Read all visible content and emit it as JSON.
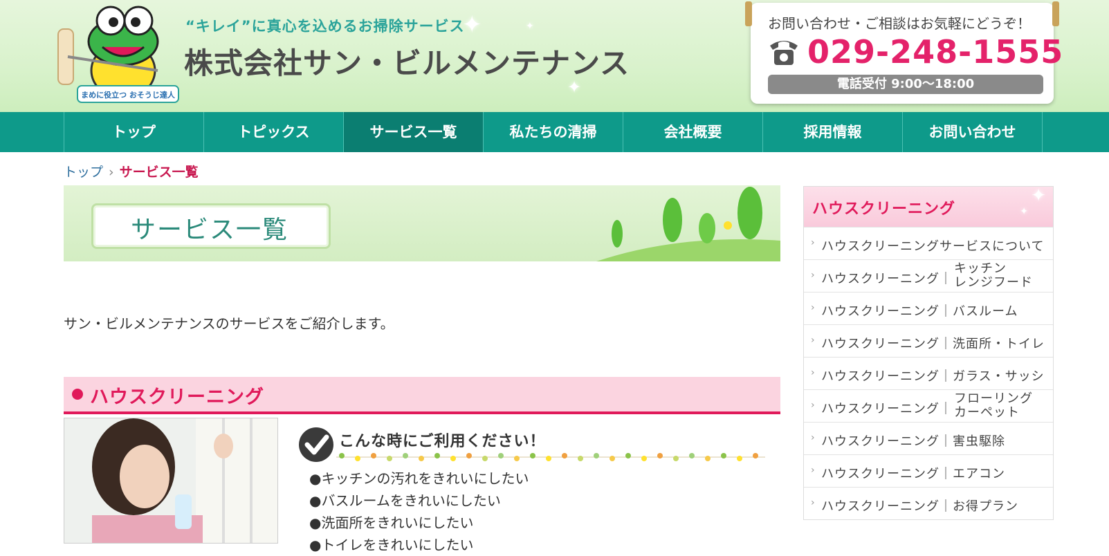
{
  "header": {
    "tagline": "“キレイ”に真心を込めるお掃除サービス",
    "company_name": "株式会社サン・ビルメンテナンス",
    "logo_caption": "まめに役立つ おそうじ達人",
    "contact_message": "お問い合わせ・ご相談はお気軽にどうぞ！",
    "phone": "029-248-1555",
    "hours": "電話受付  9:00〜18:00"
  },
  "nav": {
    "items": [
      "トップ",
      "トピックス",
      "サービス一覧",
      "私たちの清掃",
      "会社概要",
      "採用情報",
      "お問い合わせ"
    ],
    "active_index": 2
  },
  "breadcrumb": {
    "home": "トップ",
    "separator": "›",
    "current": "サービス一覧"
  },
  "banner": {
    "title": "サービス一覧"
  },
  "intro": "サン・ビルメンテナンスのサービスをご紹介します。",
  "section": {
    "title": "ハウスクリーニング",
    "usage_title": "こんな時にご利用ください！",
    "usage_items": [
      "●キッチンの汚れをきれいにしたい",
      "●バスルームをきれいにしたい",
      "●洗面所をきれいにしたい",
      "●トイレをきれいにしたい"
    ]
  },
  "sidebar": {
    "title": "ハウスクリーニング",
    "items": [
      {
        "main": "ハウスクリーニングサービスについて",
        "sub": ""
      },
      {
        "main": "ハウスクリーニング｜",
        "sub": "キッチン\nレンジフード"
      },
      {
        "main": "ハウスクリーニング｜バスルーム",
        "sub": ""
      },
      {
        "main": "ハウスクリーニング｜洗面所・トイレ",
        "sub": ""
      },
      {
        "main": "ハウスクリーニング｜ガラス・サッシ",
        "sub": ""
      },
      {
        "main": "ハウスクリーニング｜",
        "sub": "フローリング\nカーペット"
      },
      {
        "main": "ハウスクリーニング｜害虫駆除",
        "sub": ""
      },
      {
        "main": "ハウスクリーニング｜エアコン",
        "sub": ""
      },
      {
        "main": "ハウスクリーニング｜お得プラン",
        "sub": ""
      }
    ]
  },
  "colors": {
    "brand_teal": "#0e9a8a",
    "accent_pink": "#e0195a",
    "phone_pink": "#e4226a"
  }
}
